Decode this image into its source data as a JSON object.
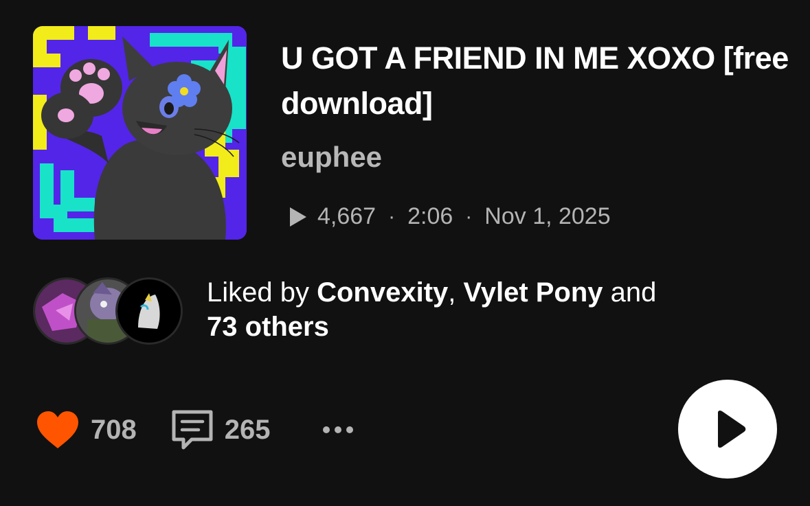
{
  "track": {
    "title": "U GOT A FRIEND IN ME XOXO [free download]",
    "artist": "euphee",
    "plays": "4,667",
    "duration": "2:06",
    "date": "Nov 1, 2025",
    "separator": "·",
    "artwork_icon": "cat-artwork"
  },
  "likes": {
    "prefix": "Liked by ",
    "user1": "Convexity",
    "comma": ", ",
    "user2": "Vylet Pony",
    "conjunction": " and",
    "others": "73 others"
  },
  "actions": {
    "like_count": "708",
    "comment_count": "265",
    "heart_color": "#ff5500",
    "icons": [
      "heart-icon",
      "comment-icon",
      "more-icon",
      "play-icon"
    ]
  },
  "colors": {
    "background": "#111111",
    "text_primary": "#ffffff",
    "text_secondary": "#b4b4b4",
    "accent": "#ff5500"
  }
}
